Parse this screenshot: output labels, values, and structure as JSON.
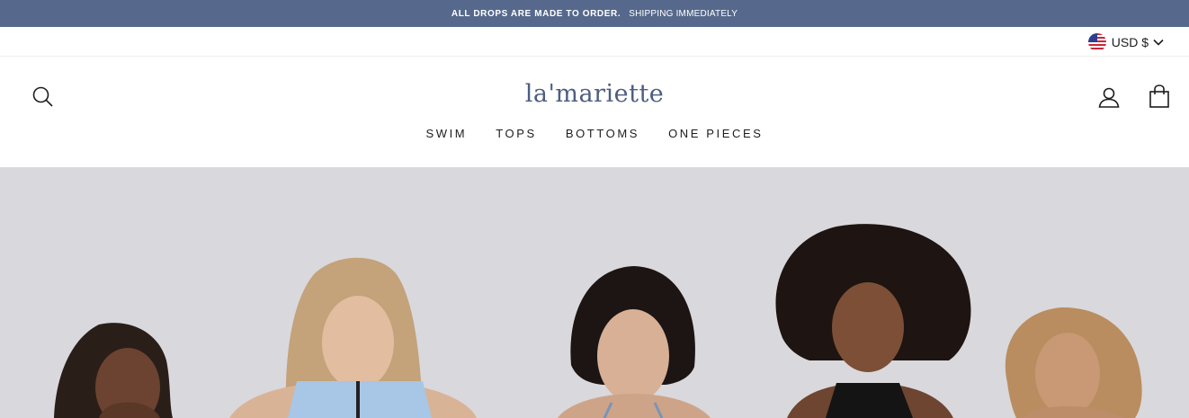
{
  "announcement": {
    "bold_text": "ALL DROPS ARE MADE TO ORDER.",
    "text": "SHIPPING IMMEDIATELY"
  },
  "currency": {
    "label": "USD $",
    "flag_icon": "us-flag-icon",
    "dropdown_icon": "chevron-down-icon"
  },
  "header": {
    "logo": "la'mariette",
    "search_icon": "search-icon",
    "account_icon": "user-icon",
    "cart_icon": "shopping-bag-icon"
  },
  "nav": {
    "items": [
      {
        "label": "SWIM"
      },
      {
        "label": "TOPS"
      },
      {
        "label": "BOTTOMS"
      },
      {
        "label": "ONE PIECES"
      }
    ]
  },
  "hero": {
    "image": "five models in swimwear against grey background"
  },
  "colors": {
    "announcement_bg": "#56698c",
    "logo": "#4d5e80",
    "hero_bg": "#d9d8dc"
  }
}
